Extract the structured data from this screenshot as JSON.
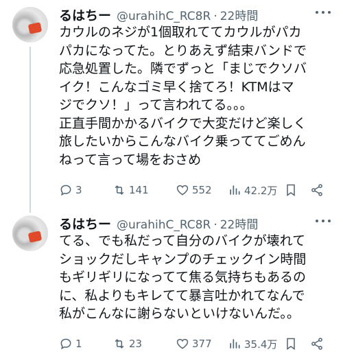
{
  "tweets": [
    {
      "name": "るはちー",
      "handle": "@urahihC_RC8R",
      "separator": "·",
      "time": "22時間",
      "lines": [
        "カウルのネジが1個取れててカウルがパカ",
        "パカになってた。とりあえず結束バンドで",
        "応急処置した。隣でずっと「まじでクソバ",
        "イク！こんなゴミ早く捨てろ！KTMはマ",
        "ジでクソ！」って言われてる。。。",
        "正直手間かかるバイクで大変だけど楽しく",
        "旅したいからこんなバイク乗っててごめん",
        "ねって言って場をおさめ"
      ],
      "replies": "3",
      "retweets": "141",
      "likes": "552",
      "views": "42.2万"
    },
    {
      "name": "るはちー",
      "handle": "@urahihC_RC8R",
      "separator": "·",
      "time": "22時間",
      "lines": [
        "てる、でも私だって自分のバイクが壊れて",
        "ショックだしキャンプのチェックイン時間",
        "もギリギリになってて焦る気持ちもあるの",
        "に、私よりもキレてて暴言吐かれてなんで",
        "私がこんなに謝らないといけないんだ。。"
      ],
      "replies": "1",
      "retweets": "23",
      "likes": "377",
      "views": "35.4万"
    }
  ],
  "icons": {
    "reply": "reply-icon",
    "retweet": "retweet-icon",
    "like": "heart-icon",
    "views": "views-chart-icon",
    "bookmark": "bookmark-icon",
    "share": "share-icon",
    "more": "more-dots-icon"
  },
  "colors": {
    "text": "#0f1419",
    "secondary": "#536471",
    "thread_line": "#cfd9de"
  }
}
